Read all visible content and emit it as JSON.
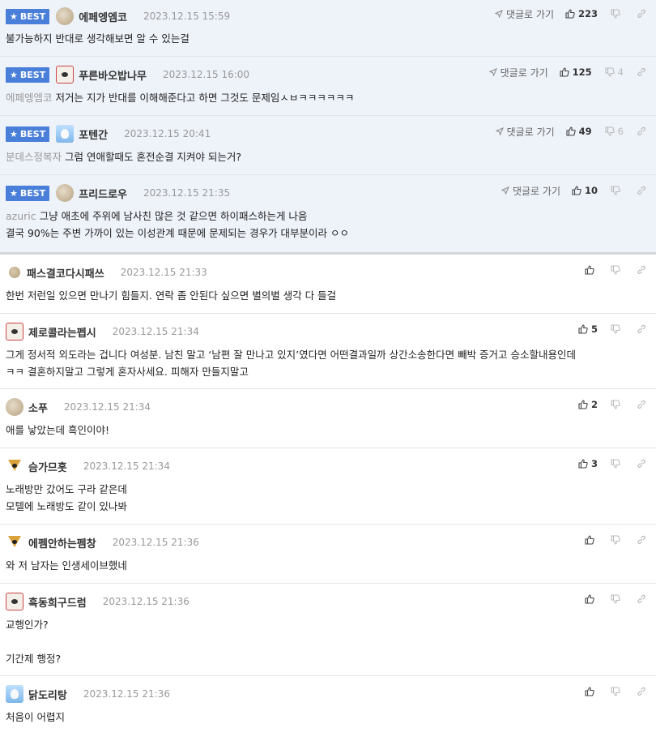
{
  "badge_label": "BEST",
  "reply_label": "댓글로 가기",
  "comments": [
    {
      "best": true,
      "avatar": "pebble-icon",
      "nick": "에페엥엠코",
      "time": "2023.12.15 15:59",
      "mention": "",
      "text": "불가능하지 반대로 생각해보면 알 수 있는걸",
      "up": "223",
      "down": ""
    },
    {
      "best": true,
      "avatar": "dog-icon",
      "nick": "푸른바오밥나무",
      "time": "2023.12.15 16:00",
      "mention": "에페엥엠코",
      "text": "저거는 지가 반대를 이해해준다고 하면 그것도 문제임ㅅㅂㅋㅋㅋㅋㅋㅋ",
      "up": "125",
      "down": "4"
    },
    {
      "best": true,
      "avatar": "penguin-icon",
      "nick": "포텐간",
      "time": "2023.12.15 20:41",
      "mention": "분데스정복자",
      "text": "그럼 연애할때도 혼전순결 지켜야 되는거?",
      "up": "49",
      "down": "6"
    },
    {
      "best": true,
      "avatar": "pebble-icon",
      "nick": "프리드로우",
      "time": "2023.12.15 21:35",
      "mention": "azuric",
      "text": "그냥 애초에 주위에 남사친 많은 것 같으면 하이패스하는게 나음\n결국 90%는 주변 가까이 있는 이성관계 때문에 문제되는 경우가 대부분이라 ㅇㅇ",
      "up": "10",
      "down": ""
    },
    {
      "best": false,
      "avatar": "dot-icon",
      "nick": "패스결코다시패쓰",
      "time": "2023.12.15 21:33",
      "mention": "",
      "text": "한번 저런일 있으면 만나기 힘들지. 연락 좀 안된다 싶으면 별의별 생각 다 들걸",
      "up": "",
      "down": ""
    },
    {
      "best": false,
      "avatar": "dog-icon",
      "nick": "제로콜라는펩시",
      "time": "2023.12.15 21:34",
      "mention": "",
      "text": "그게 정서적 외도라는 겁니다 여성분. 남친 말고 ‘남편 잘 만나고 있지’였다면 어떤결과일까 상간소송한다면 빼박 증거고 승소할내용인데\nㅋㅋ 결혼하지말고 그렇게 혼자사세요. 피해자 만들지말고",
      "up": "5",
      "down": ""
    },
    {
      "best": false,
      "avatar": "pebble-icon",
      "nick": "소푸",
      "time": "2023.12.15 21:34",
      "mention": "",
      "text": "애를 낳았는데 흑인이야!",
      "up": "2",
      "down": ""
    },
    {
      "best": false,
      "avatar": "fox-icon",
      "nick": "슴가므흣",
      "time": "2023.12.15 21:34",
      "mention": "",
      "text": "노래방만 갔어도 구라 같은데\n모텔에 노래방도 같이 있나봐",
      "up": "3",
      "down": ""
    },
    {
      "best": false,
      "avatar": "fox-icon",
      "nick": "에펨안하는펨창",
      "time": "2023.12.15 21:36",
      "mention": "",
      "text": "와 저 남자는 인생세이브했네",
      "up": "",
      "down": ""
    },
    {
      "best": false,
      "avatar": "dog-icon",
      "nick": "흑동희구드럼",
      "time": "2023.12.15 21:36",
      "mention": "",
      "text": "교행인가?\n\n기간제 행정?",
      "up": "",
      "down": ""
    },
    {
      "best": false,
      "avatar": "penguin-icon",
      "nick": "닭도리탕",
      "time": "2023.12.15 21:36",
      "mention": "",
      "text": "처음이 어렵지",
      "up": "",
      "down": ""
    }
  ]
}
